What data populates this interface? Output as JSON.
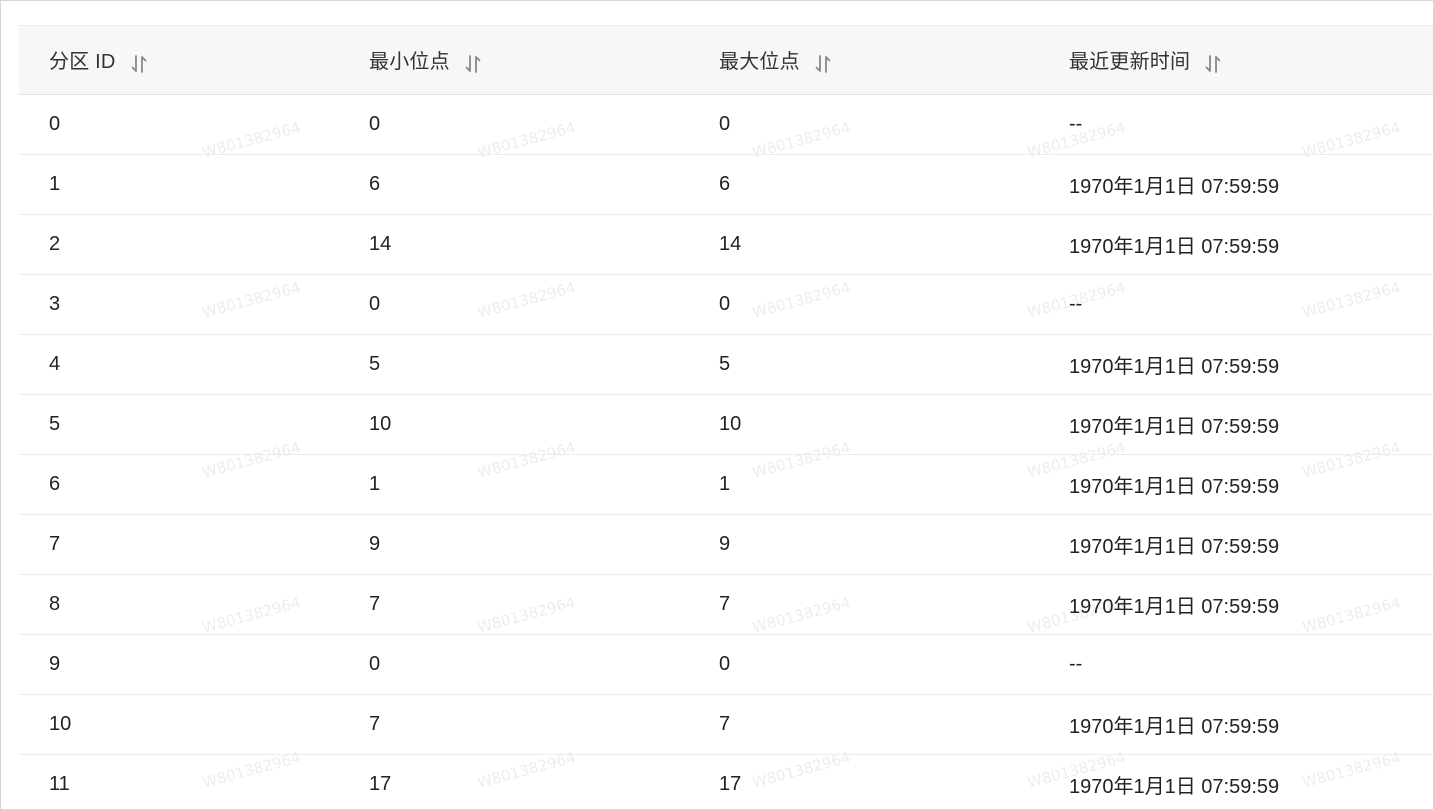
{
  "table": {
    "headers": [
      {
        "label": "分区 ID",
        "sort_icon": "sort-icon"
      },
      {
        "label": "最小位点",
        "sort_icon": "sort-icon"
      },
      {
        "label": "最大位点",
        "sort_icon": "sort-icon"
      },
      {
        "label": "最近更新时间",
        "sort_icon": "sort-icon"
      }
    ],
    "rows": [
      [
        "0",
        "0",
        "0",
        "--"
      ],
      [
        "1",
        "6",
        "6",
        "1970年1月1日 07:59:59"
      ],
      [
        "2",
        "14",
        "14",
        "1970年1月1日 07:59:59"
      ],
      [
        "3",
        "0",
        "0",
        "--"
      ],
      [
        "4",
        "5",
        "5",
        "1970年1月1日 07:59:59"
      ],
      [
        "5",
        "10",
        "10",
        "1970年1月1日 07:59:59"
      ],
      [
        "6",
        "1",
        "1",
        "1970年1月1日 07:59:59"
      ],
      [
        "7",
        "9",
        "9",
        "1970年1月1日 07:59:59"
      ],
      [
        "8",
        "7",
        "7",
        "1970年1月1日 07:59:59"
      ],
      [
        "9",
        "0",
        "0",
        "--"
      ],
      [
        "10",
        "7",
        "7",
        "1970年1月1日 07:59:59"
      ],
      [
        "11",
        "17",
        "17",
        "1970年1月1日 07:59:59"
      ]
    ]
  },
  "watermark": {
    "text": "W801382964"
  },
  "colors": {
    "header_bg": "#f7f7f7",
    "border": "#ececec",
    "text": "#222222",
    "watermark": "#ededed"
  }
}
